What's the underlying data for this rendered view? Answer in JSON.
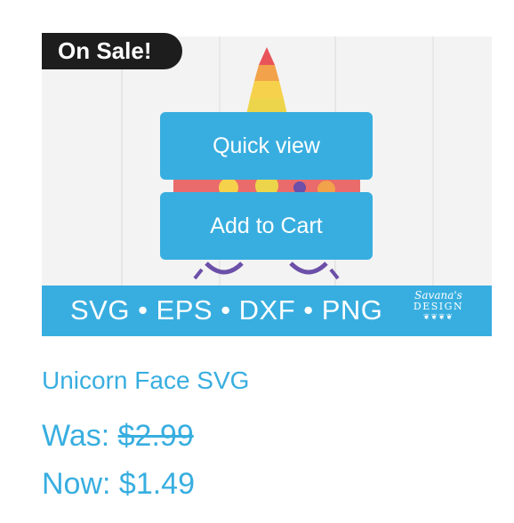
{
  "product": {
    "sale_badge": "On Sale!",
    "quick_view_label": "Quick view",
    "add_to_cart_label": "Add to Cart",
    "banner_formats": "SVG • EPS • DXF • PNG",
    "brand_script": "Savana's",
    "brand_word": "DESIGN",
    "brand_leaves": "❦❦❦❦",
    "title": "Unicorn Face SVG",
    "was_label": "Was: ",
    "was_price": "$2.99",
    "now_label": "Now: ",
    "now_price": "$1.49"
  },
  "colors": {
    "accent": "#38aee0",
    "badge_bg": "#1d1d1d",
    "background": "#ffffff"
  }
}
